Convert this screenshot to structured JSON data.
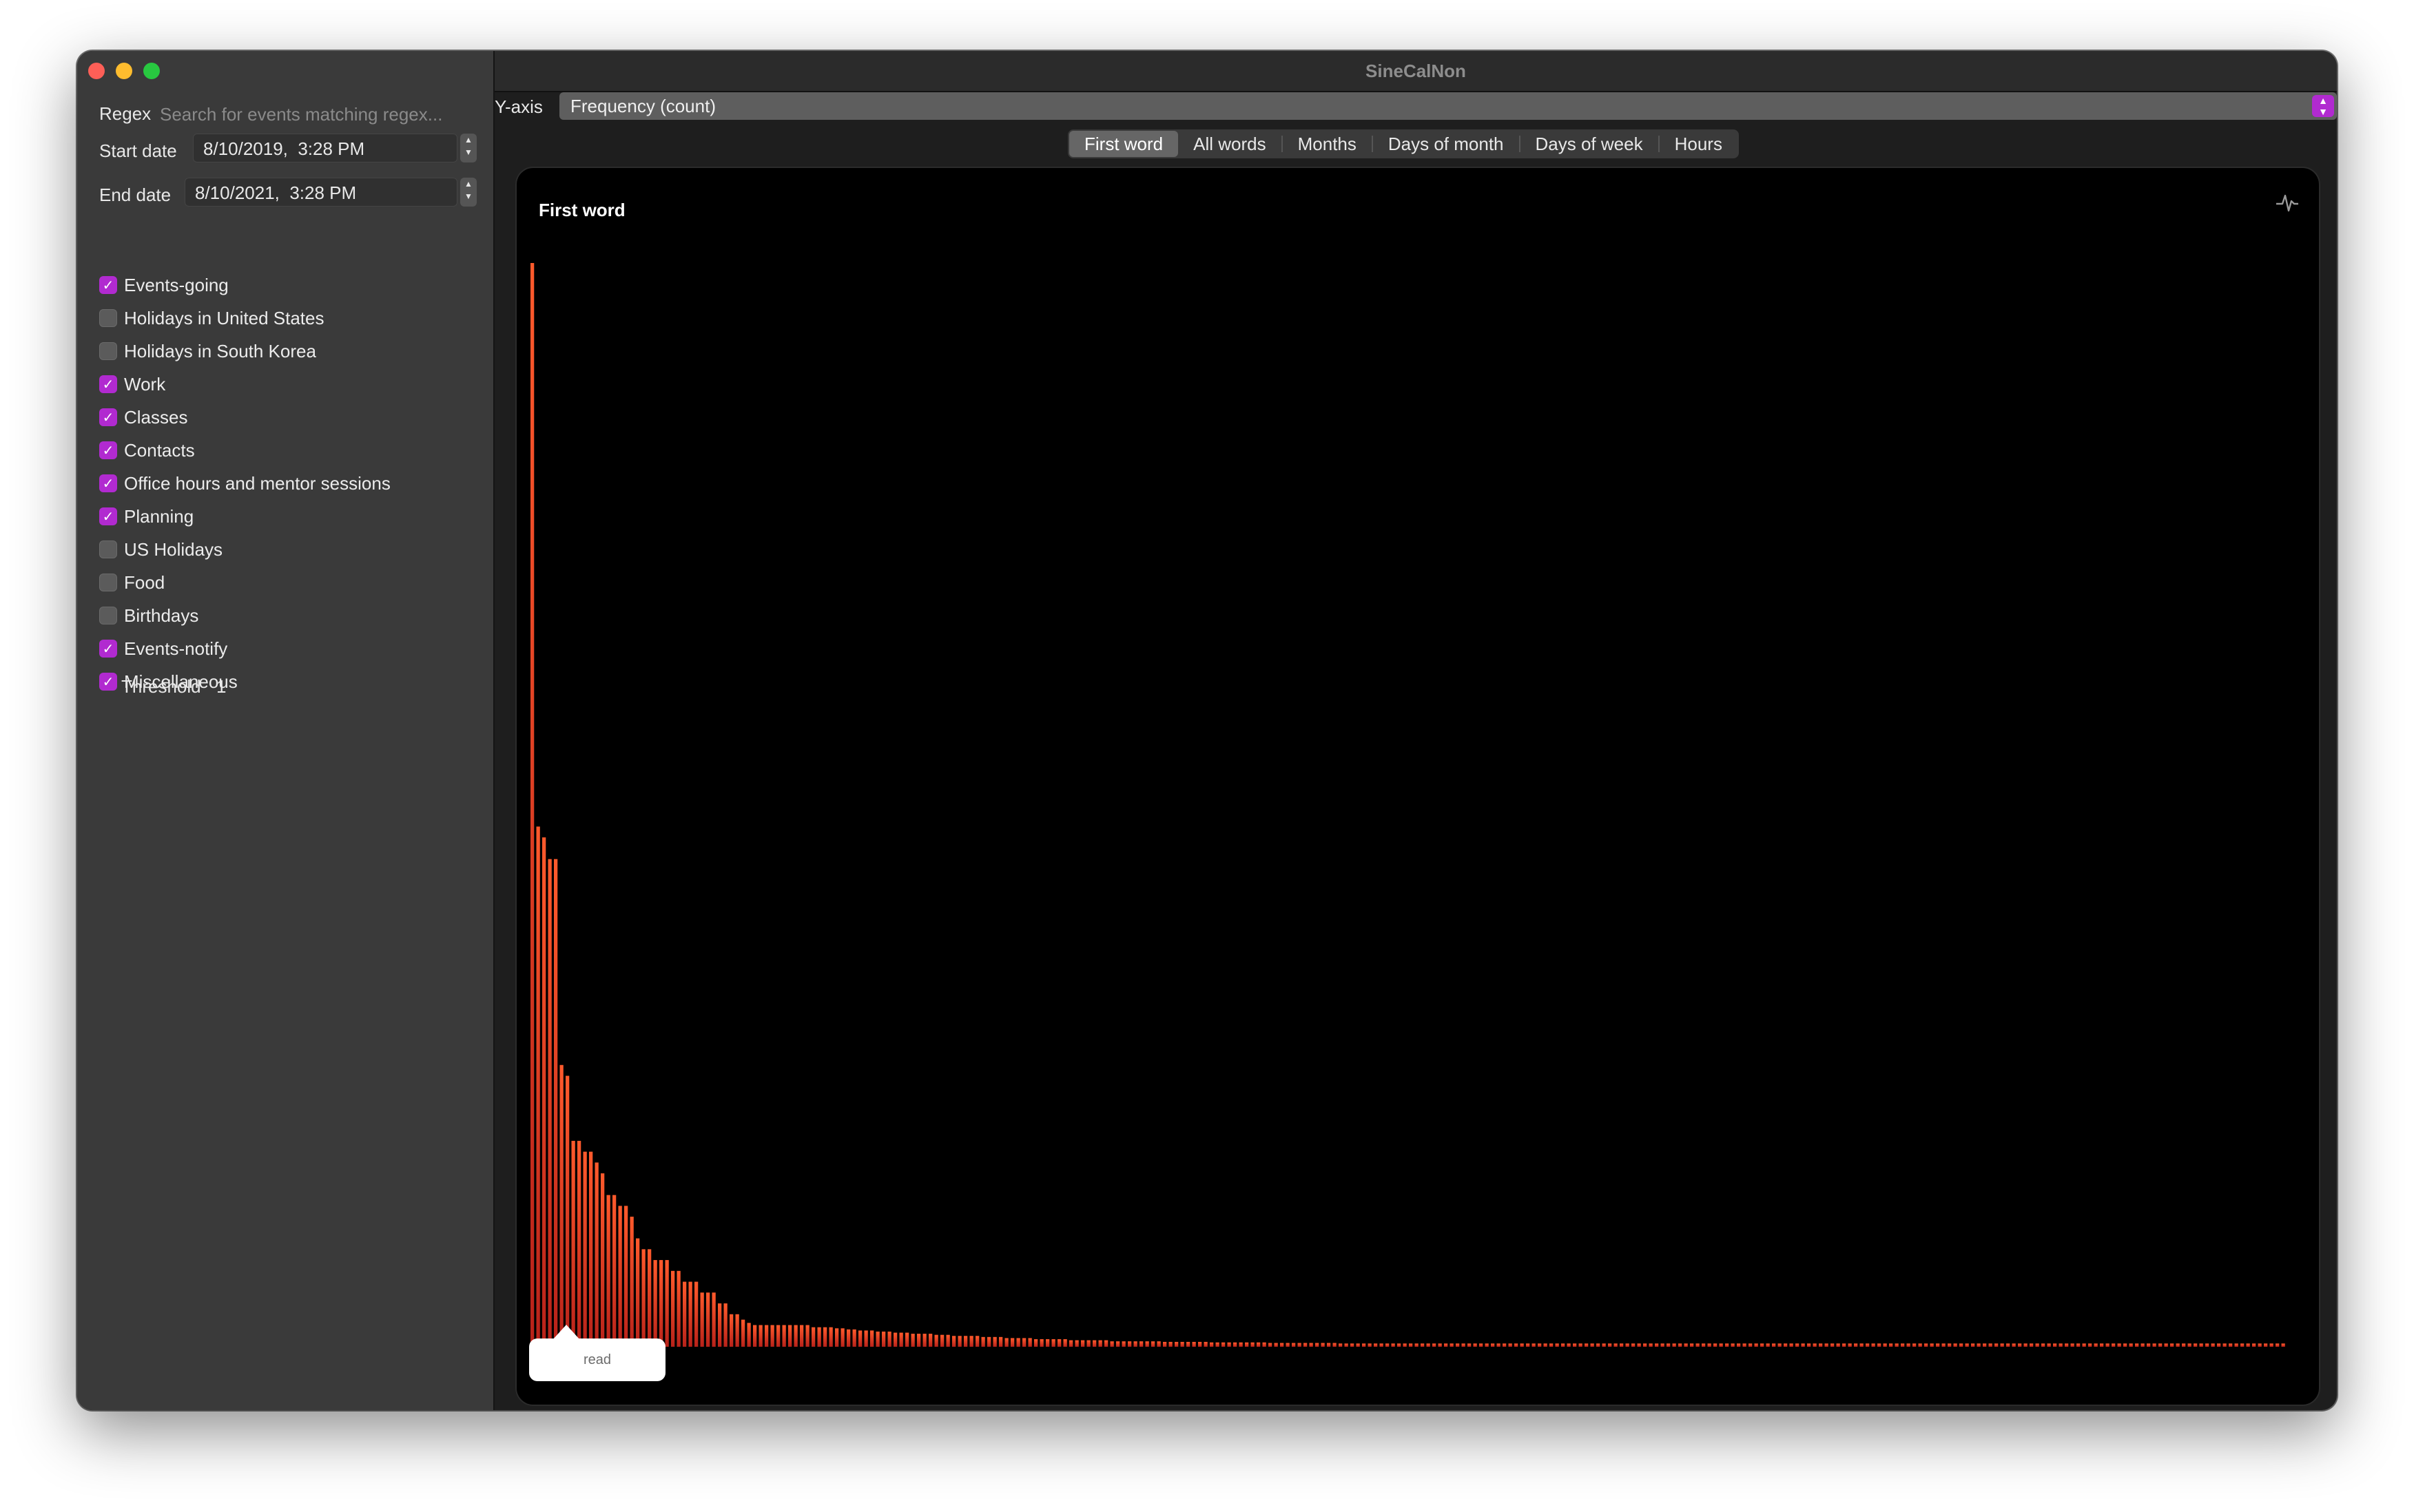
{
  "window": {
    "title": "SineCalNon"
  },
  "sidebar": {
    "regex_label": "Regex",
    "regex_placeholder": "Search for events matching regex...",
    "start_date_label": "Start date",
    "start_date_value": "8/10/2019,  3:28 PM",
    "end_date_label": "End date",
    "end_date_value": "8/10/2021,  3:28 PM",
    "calendars": [
      {
        "name": "Events-going",
        "checked": true
      },
      {
        "name": "Holidays in United States",
        "checked": false
      },
      {
        "name": "Holidays in South Korea",
        "checked": false
      },
      {
        "name": "Work",
        "checked": true
      },
      {
        "name": "Classes",
        "checked": true
      },
      {
        "name": "Contacts",
        "checked": true
      },
      {
        "name": "Office hours and mentor sessions",
        "checked": true
      },
      {
        "name": "Planning",
        "checked": true
      },
      {
        "name": "US Holidays",
        "checked": false
      },
      {
        "name": "Food",
        "checked": false
      },
      {
        "name": "Birthdays",
        "checked": false
      },
      {
        "name": "Events-notify",
        "checked": true
      },
      {
        "name": "Miscellaneous",
        "checked": true
      }
    ],
    "threshold_label": "Threshold",
    "threshold_value": "1"
  },
  "yaxis": {
    "label": "Y-axis",
    "selected": "Frequency (count)"
  },
  "tabs": [
    {
      "label": "First word",
      "active": true
    },
    {
      "label": "All words",
      "active": false
    },
    {
      "label": "Months",
      "active": false
    },
    {
      "label": "Days of month",
      "active": false
    },
    {
      "label": "Days of week",
      "active": false
    },
    {
      "label": "Hours",
      "active": false
    }
  ],
  "chart": {
    "title": "First word",
    "tooltip": "read"
  },
  "colors": {
    "accent": "#b12ad0",
    "bar_top": "#ff5a2c",
    "bar_bottom": "#b8221a"
  },
  "chart_data": {
    "type": "bar",
    "title": "First word",
    "ylabel": "Frequency (count)",
    "sorted": "descending",
    "grid": false,
    "selected_category": "read",
    "values": [
      100,
      48,
      47,
      45,
      45,
      26,
      25,
      19,
      19,
      18,
      18,
      17,
      16,
      14,
      14,
      13,
      13,
      12,
      10,
      9,
      9,
      8,
      8,
      8,
      7,
      7,
      6,
      6,
      6,
      5,
      5,
      5,
      4,
      4,
      3,
      3,
      2.5,
      2.2,
      2,
      2,
      2,
      2,
      2,
      2,
      2,
      2,
      2,
      2,
      1.8,
      1.8,
      1.8,
      1.8,
      1.7,
      1.7,
      1.6,
      1.6,
      1.5,
      1.5,
      1.5,
      1.4,
      1.4,
      1.4,
      1.3,
      1.3,
      1.3,
      1.2,
      1.2,
      1.2,
      1.2,
      1.1,
      1.1,
      1.1,
      1,
      1,
      1,
      1,
      1,
      0.9,
      0.9,
      0.9,
      0.9,
      0.8,
      0.8,
      0.8,
      0.8,
      0.8,
      0.7,
      0.7,
      0.7,
      0.7,
      0.7,
      0.7,
      0.6,
      0.6,
      0.6,
      0.6,
      0.6,
      0.6,
      0.6,
      0.5,
      0.5,
      0.5,
      0.5,
      0.5,
      0.5,
      0.5,
      0.5,
      0.5,
      0.45,
      0.45,
      0.45,
      0.45,
      0.45,
      0.45,
      0.45,
      0.45,
      0.4,
      0.4,
      0.4,
      0.4,
      0.4,
      0.4,
      0.4,
      0.4,
      0.4,
      0.4,
      0.35,
      0.35,
      0.35,
      0.35,
      0.35,
      0.35,
      0.35,
      0.35,
      0.35,
      0.35,
      0.35,
      0.35,
      0.3,
      0.3,
      0.3,
      0.3,
      0.3,
      0.3,
      0.3,
      0.3,
      0.3,
      0.3,
      0.3,
      0.3,
      0.3,
      0.3,
      0.3,
      0.3,
      0.3,
      0.3,
      0.3,
      0.3,
      0.3,
      0.3,
      0.3,
      0.3,
      0.3,
      0.3,
      0.3,
      0.3,
      0.3,
      0.3,
      0.3,
      0.3,
      0.3,
      0.3,
      0.3,
      0.3,
      0.3,
      0.3,
      0.3,
      0.3,
      0.3,
      0.3,
      0.3,
      0.3,
      0.3,
      0.3,
      0.3,
      0.3,
      0.3,
      0.3,
      0.3,
      0.3,
      0.3,
      0.3,
      0.3,
      0.3,
      0.3,
      0.3,
      0.3,
      0.3,
      0.3,
      0.3,
      0.3,
      0.3,
      0.3,
      0.3,
      0.3,
      0.3,
      0.3,
      0.3,
      0.3,
      0.3,
      0.3,
      0.3,
      0.3,
      0.3,
      0.3,
      0.3,
      0.3,
      0.3,
      0.3,
      0.3,
      0.3,
      0.3,
      0.3,
      0.3,
      0.3,
      0.3,
      0.3,
      0.3,
      0.3,
      0.3,
      0.3,
      0.3,
      0.3,
      0.3,
      0.3,
      0.3,
      0.3,
      0.3,
      0.3,
      0.3,
      0.3,
      0.3,
      0.3,
      0.3,
      0.3,
      0.3,
      0.3,
      0.3,
      0.3,
      0.3,
      0.3,
      0.3,
      0.3,
      0.3,
      0.3,
      0.3,
      0.3,
      0.3,
      0.3,
      0.3,
      0.3,
      0.3,
      0.3,
      0.3,
      0.3,
      0.3,
      0.3,
      0.3,
      0.3,
      0.3,
      0.3,
      0.3,
      0.3,
      0.3,
      0.3,
      0.3,
      0.3,
      0.3,
      0.3,
      0.3,
      0.3,
      0.3,
      0.3,
      0.3,
      0.3,
      0.3,
      0.3,
      0.3,
      0.3,
      0.3,
      0.3,
      0.3,
      0.3,
      0.3,
      0.3,
      0.3,
      0.3,
      0.3,
      0.3,
      0.3
    ]
  }
}
